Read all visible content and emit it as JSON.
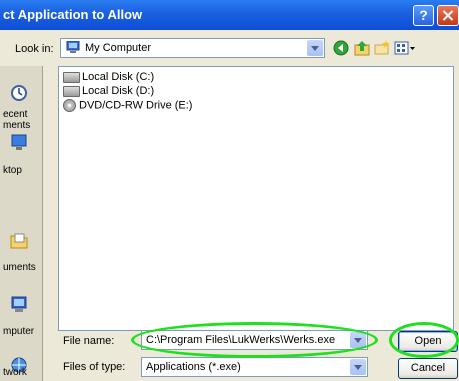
{
  "window": {
    "title": "ct Application to Allow",
    "help_label": "?"
  },
  "lookin": {
    "label": "Look in:",
    "value": "My Computer"
  },
  "places": [
    {
      "label": "ecent\nments",
      "icon": "recent-documents-icon"
    },
    {
      "label": "ktop",
      "icon": "desktop-icon"
    },
    {
      "label": "uments",
      "icon": "my-documents-icon"
    },
    {
      "label": "mputer",
      "icon": "my-computer-icon"
    },
    {
      "label": "twork",
      "icon": "network-icon"
    }
  ],
  "files": [
    {
      "label": "Local Disk (C:)",
      "icon": "drive-icon"
    },
    {
      "label": "Local Disk (D:)",
      "icon": "drive-icon"
    },
    {
      "label": "DVD/CD-RW Drive (E:)",
      "icon": "cd-drive-icon"
    }
  ],
  "filename": {
    "label": "File name:",
    "value": "C:\\Program Files\\LukWerks\\Werks.exe"
  },
  "filetype": {
    "label": "Files of type:",
    "value": "Applications (*.exe)"
  },
  "buttons": {
    "open": "Open",
    "cancel": "Cancel"
  },
  "colors": {
    "titlebar": "#0d4fd6",
    "dialog_bg": "#ece9d8",
    "highlight": "#1ee01e"
  }
}
